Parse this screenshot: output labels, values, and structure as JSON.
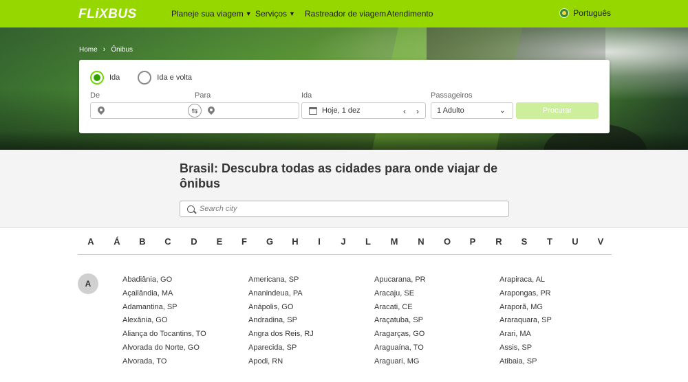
{
  "header": {
    "logo": "FLiXBUS",
    "nav": [
      {
        "label": "Planeje sua viagem",
        "chevron": true
      },
      {
        "label": "Serviços",
        "chevron": true
      },
      {
        "label": "Rastreador de viagem",
        "chevron": false
      },
      {
        "label": "Atendimento",
        "chevron": false
      }
    ],
    "language": "Português"
  },
  "breadcrumb": {
    "home": "Home",
    "current": "Ônibus"
  },
  "search": {
    "trip_one_way": "Ida",
    "trip_round": "Ida e volta",
    "from_label": "De",
    "to_label": "Para",
    "date_label": "Ida",
    "date_value": "Hoje, 1 dez",
    "passengers_label": "Passageiros",
    "passengers_value": "1 Adulto",
    "submit": "Procurar"
  },
  "main": {
    "title": "Brasil: Descubra todas as cidades para onde viajar de ônibus",
    "city_search_placeholder": "Search city",
    "alphabet": [
      "A",
      "Á",
      "B",
      "C",
      "D",
      "E",
      "F",
      "G",
      "H",
      "I",
      "J",
      "L",
      "M",
      "N",
      "O",
      "P",
      "R",
      "S",
      "T",
      "U",
      "V"
    ],
    "section_letter": "A",
    "columns": [
      [
        "Abadiânia, GO",
        "Açailândia, MA",
        "Adamantina, SP",
        "Alexânia, GO",
        "Aliança do Tocantins, TO",
        "Alvorada do Norte, GO",
        "Alvorada, TO"
      ],
      [
        "Americana, SP",
        "Ananindeua, PA",
        "Anápolis, GO",
        "Andradina, SP",
        "Angra dos Reis, RJ",
        "Aparecida, SP",
        "Apodi, RN"
      ],
      [
        "Apucarana, PR",
        "Aracaju, SE",
        "Aracati, CE",
        "Araçatuba, SP",
        "Aragarças, GO",
        "Araguaína, TO",
        "Araguari, MG"
      ],
      [
        "Arapiraca, AL",
        "Arapongas, PR",
        "Araporã, MG",
        "Araraquara, SP",
        "Arari, MA",
        "Assis, SP",
        "Atibaia, SP"
      ]
    ]
  },
  "colors": {
    "brand": "#97d700",
    "selected": "#31a100",
    "button_disabled": "#cdef9b"
  }
}
